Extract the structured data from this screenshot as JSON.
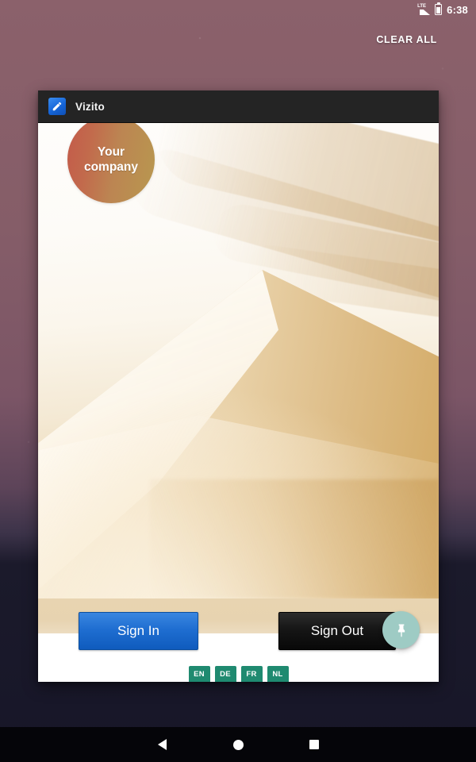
{
  "status_bar": {
    "time": "6:38",
    "signal_label": "LTE",
    "signal_icon": "signal-lte-icon",
    "battery_icon": "battery-icon"
  },
  "recents": {
    "clear_all_label": "CLEAR ALL"
  },
  "task_card": {
    "app_icon": "pencil-edit-icon",
    "app_title": "Vizito"
  },
  "app": {
    "logo": {
      "line1": "Your",
      "line2": "company"
    },
    "sign_in_label": "Sign In",
    "sign_out_label": "Sign Out",
    "fab_icon": "pushpin-icon",
    "languages": [
      {
        "code": "EN"
      },
      {
        "code": "DE"
      },
      {
        "code": "FR"
      },
      {
        "code": "NL"
      }
    ]
  },
  "nav_bar": {
    "back_icon": "back-triangle-icon",
    "home_icon": "home-circle-icon",
    "recents_icon": "recents-square-icon"
  },
  "colors": {
    "accent_blue": "#1f6ed1",
    "accent_black": "#161616",
    "accent_teal": "#1f8a70",
    "fab_teal": "#9ecbc4",
    "wallpaper_top": "#8b616b",
    "wallpaper_bottom": "#171628"
  }
}
